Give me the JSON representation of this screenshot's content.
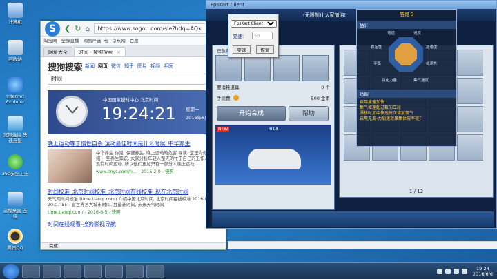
{
  "desktop": {
    "icons": [
      "计算机",
      "回收站",
      "Internet Explorer",
      "宽带连接 快速连接",
      "360安全卫士",
      "远程桌面 连接",
      "腾讯QQ"
    ]
  },
  "browser": {
    "url": "https://www.sogou.com/sie?hdq=AQx",
    "bookmarks": [
      "淘宝网",
      "全部直播",
      "网易严选_电",
      "京东网",
      "百度"
    ],
    "tabs": [
      {
        "label": "网址大全"
      },
      {
        "label": "时间 - 搜狗搜索"
      }
    ],
    "search": {
      "logo_text": "搜狗搜索",
      "nav": [
        "新闻",
        "网页",
        "微信",
        "知乎",
        "图片",
        "视频",
        "明医"
      ],
      "query": "时间"
    },
    "clock": {
      "label": "中国国家授时中心 北京时间",
      "time": "19:24:21",
      "day": "星期一",
      "date": "2016年6月6"
    },
    "results": [
      {
        "title": "晚上运动等于慢性自杀 运动最佳时间是什么时候_中华养生",
        "snippet": "中华养生 你足: 保健养生, 晚上运动的危害 导读: 这里为你推荐介绍 一些养生知识, 大家分析年轻人整天的忙于自己的工作, 根本没有时间运动, 所以他们更加只有一部分人晚上运动",
        "url": "www.cnys.com/h... - 2015-2-9 - 快照"
      },
      {
        "title": "时间校准_北京时间校准_北京时间在线校准_现在北京时间",
        "snippet": "天气网时间校准 (time.tianqi.com) 介绍中国北京时间, 北京时间在线校准 2016-06-05 20:07:55 - 宣世界各大城市时间, 独最新时间, 未来天气时间",
        "url": "time.tianqi.com/ - 2016-6-5 - 快照"
      },
      {
        "title": "时间在线观看-搜狗影视导航"
      }
    ],
    "status": "完成"
  },
  "dialog": {
    "select_value": "FpsKart Client",
    "speed_label": "变速:",
    "speed_value": "50",
    "speed_button": "变速",
    "restore_button": "恢复"
  },
  "game": {
    "title": "FpsKart Client",
    "top_text": "(无限制)] 大家加油!!",
    "left": {
      "slots_label": "已放弃车辆",
      "field1": "要消耗道具",
      "field1_value": "0 个",
      "field2": "手续费",
      "field2_value": "500 金币",
      "synth_button": "开始合成",
      "help_button": "帮助",
      "new_badge": "NEW",
      "car_name": "BD-9"
    },
    "pager": "1 / 12",
    "tooltip": {
      "title": "酷跑 9",
      "sec1": "估计",
      "stats": [
        "弯道",
        "速度",
        "稳定性",
        "加速度",
        "平衡",
        "加速性",
        "强化力量",
        "集气速度"
      ],
      "sec2": "功能",
      "func_text": "启用集速加快\n集气增速超过数的车段\n漂移时加中快速每次增加氮气\n启用无漏-力加速效果集体效率提升"
    }
  },
  "taskbar": {
    "time": "19:24",
    "date": "2016/6/6"
  }
}
